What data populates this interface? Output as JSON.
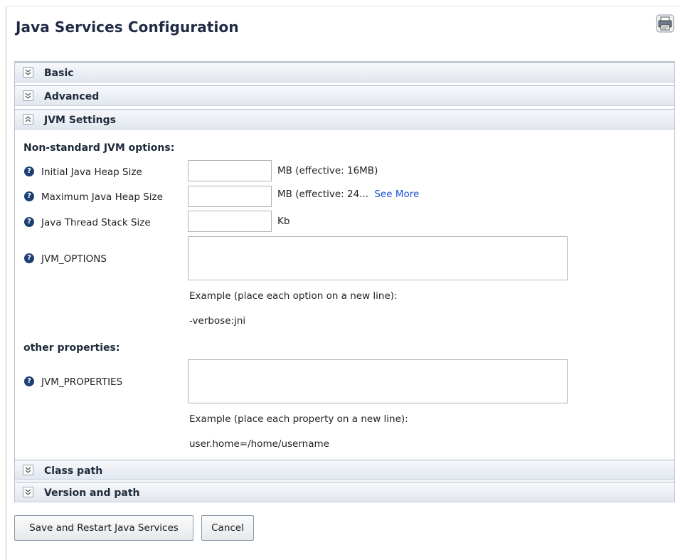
{
  "page": {
    "title": "Java Services Configuration"
  },
  "icons": {
    "print": "printer-icon",
    "help": "question-circle-icon",
    "expand": "chevron-double-down-icon",
    "collapse": "chevron-double-up-icon"
  },
  "sections": {
    "basic": {
      "label": "Basic",
      "expanded": false
    },
    "advanced": {
      "label": "Advanced",
      "expanded": false
    },
    "jvm": {
      "label": "JVM Settings",
      "expanded": true
    },
    "classpath": {
      "label": "Class path",
      "expanded": false
    },
    "version": {
      "label": "Version and path",
      "expanded": false
    }
  },
  "jvm": {
    "nonstandard_heading": "Non-standard JVM options:",
    "initial_heap": {
      "label": "Initial Java Heap Size",
      "value": "",
      "suffix": "MB (effective: 16MB)"
    },
    "max_heap": {
      "label": "Maximum Java Heap Size",
      "value": "",
      "suffix": "MB (effective: 24...",
      "see_more": "See More"
    },
    "thread_stack": {
      "label": "Java Thread Stack Size",
      "value": "",
      "suffix": "Kb"
    },
    "jvm_options": {
      "label": "JVM_OPTIONS",
      "value": "",
      "example": "Example (place each option on a new line):",
      "example_value": "-verbose:jni"
    },
    "other_heading": "other properties:",
    "jvm_properties": {
      "label": "JVM_PROPERTIES",
      "value": "",
      "example": "Example (place each property on a new line):",
      "example_value": "user.home=/home/username"
    }
  },
  "actions": {
    "save": "Save and Restart Java Services",
    "cancel": "Cancel"
  },
  "colors": {
    "header_gradient_top": "#f6f8fb",
    "header_gradient_bottom": "#e2e7ef",
    "help_icon": "#1c3f74",
    "link": "#1a4fd0"
  }
}
